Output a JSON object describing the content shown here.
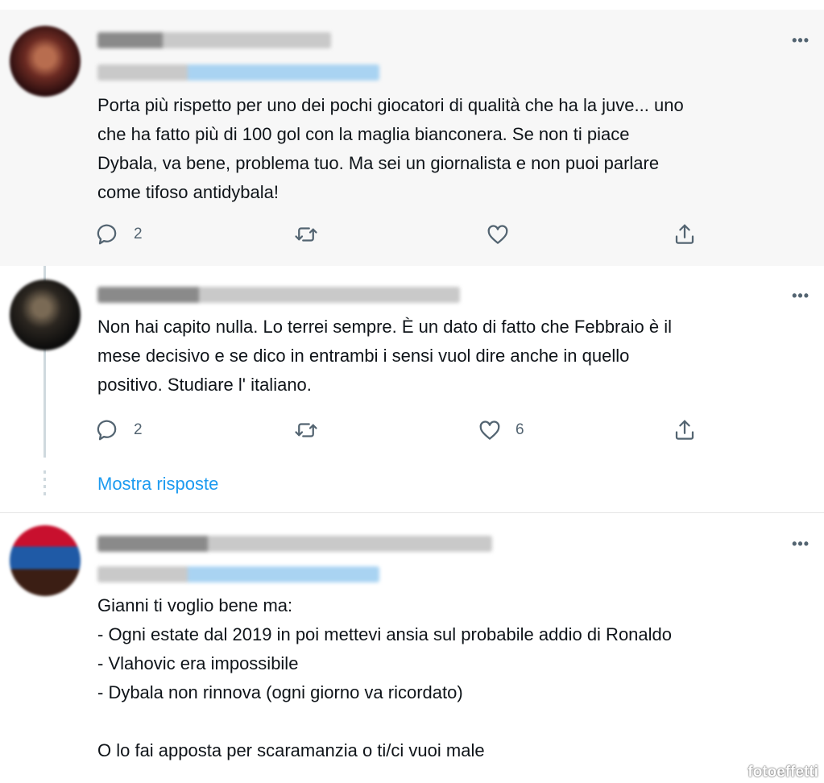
{
  "tweets": [
    {
      "text_lines": [
        "Porta più rispetto per uno dei pochi giocatori di qualità che ha la juve... uno",
        "che ha fatto più di 100 gol con la maglia bianconera. Se non ti piace",
        "Dybala, va bene, problema tuo. Ma sei un giornalista e non puoi parlare",
        "come tifoso antidybala!"
      ],
      "reply_count": "2",
      "like_count": ""
    },
    {
      "text_lines": [
        "Non hai capito nulla. Lo terrei sempre. È un dato di fatto che Febbraio è il",
        "mese decisivo e se dico in entrambi i sensi vuol dire anche in quello",
        "positivo. Studiare l' italiano."
      ],
      "reply_count": "2",
      "like_count": "6"
    },
    {
      "text_lines": [
        "Gianni ti voglio bene ma:",
        "- Ogni estate dal 2019 in poi mettevi ansia sul probabile addio di Ronaldo",
        "- Vlahovic era impossibile",
        "- Dybala non rinnova (ogni giorno va ricordato)",
        "",
        "O lo fai apposta per scaramanzia o ti/ci vuoi male"
      ]
    }
  ],
  "show_replies_label": "Mostra risposte",
  "more_label": "•••",
  "watermark": "fotoeffetti",
  "icons": {
    "reply": "reply-icon",
    "retweet": "retweet-icon",
    "like": "like-icon",
    "share": "share-icon"
  },
  "colors": {
    "link": "#1d9bf0",
    "muted": "#536471",
    "highlight_bg": "#f7f7f7"
  }
}
